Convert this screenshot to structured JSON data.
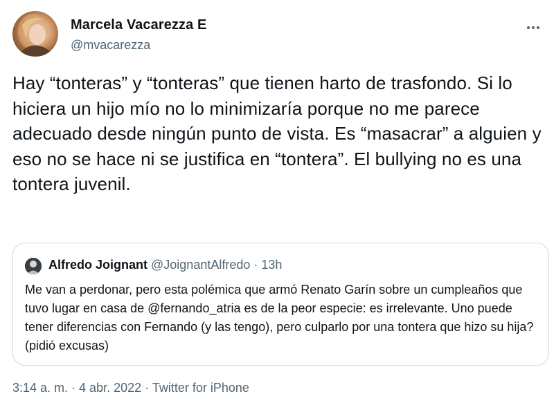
{
  "author": {
    "name": "Marcela Vacarezza E",
    "handle": "@mvacarezza"
  },
  "more_icon": "ellipsis-horizontal-icon",
  "tweet_text": "Hay “tonteras” y “tonteras” que tienen harto de trasfondo. Si lo hiciera un hijo mío no lo minimizaría porque no me parece adecuado desde ningún punto de vista. Es “masacrar” a alguien y eso no se hace ni se justifica en “tontera”. El bullying no es una tontera juvenil.",
  "quoted_tweet": {
    "name": "Alfredo Joignant",
    "handle": "@JoignantAlfredo",
    "separator": " · ",
    "time": "13h",
    "text": "Me van a perdonar, pero esta polémica que armó Renato Garín sobre un cumpleaños que tuvo lugar en casa de @fernando_atria es de la peor especie: es irrelevante. Uno puede tener diferencias con Fernando (y las tengo), pero culparlo por una tontera que hizo su hija? (pidió excusas)"
  },
  "footer": {
    "time": "3:14 a. m.",
    "separator": " · ",
    "date": "4 abr. 2022",
    "source": "Twitter for iPhone"
  },
  "colors": {
    "text_primary": "#0f1419",
    "text_secondary": "#536471",
    "border": "#cfd9de"
  }
}
